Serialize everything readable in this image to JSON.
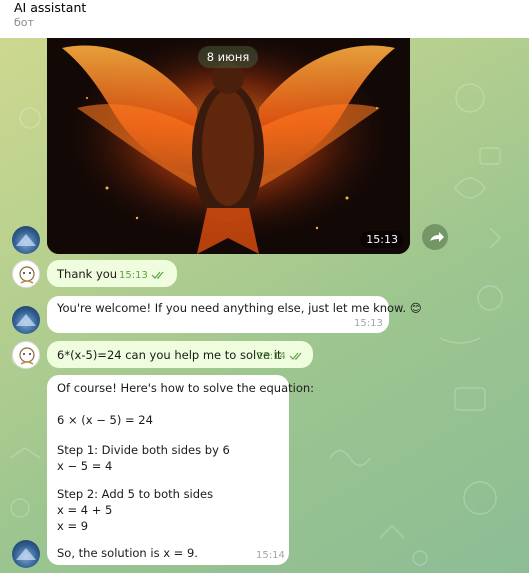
{
  "header": {
    "title": "AI assistant",
    "subtitle": "бот"
  },
  "date_separator": "8 июня",
  "photo": {
    "time": "15:13"
  },
  "messages": [
    {
      "sender": "user",
      "text": "Thank you",
      "time": "15:13"
    },
    {
      "sender": "bot",
      "text": "You're welcome! If you need anything else, just let me know. 😊",
      "time": "15:13"
    },
    {
      "sender": "user",
      "text": "6*(x-5)=24 can you help me to solve it",
      "time": "15:14"
    },
    {
      "sender": "bot",
      "time": "15:14",
      "lines": [
        "Of course! Here's how to solve the equation:",
        "6 × (x − 5) = 24",
        "Step 1: Divide both sides by 6",
        "x − 5 = 4",
        "Step 2: Add 5 to both sides",
        "x = 4 + 5",
        "x = 9",
        "So, the solution is x = 9."
      ]
    }
  ],
  "colors": {
    "user_bubble": "#effdde",
    "bot_bubble": "#ffffff",
    "read_check": "#5ea24b"
  }
}
